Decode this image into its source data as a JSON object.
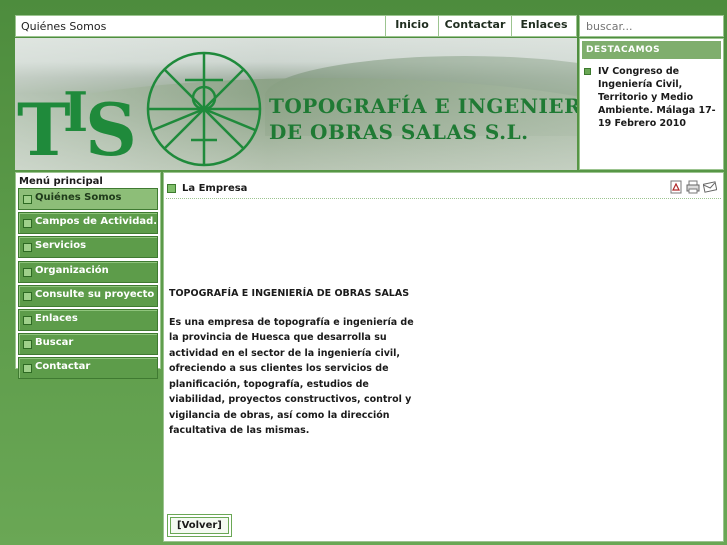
{
  "topbar": {
    "crumb": "Quiénes Somos",
    "nav": [
      "Inicio",
      "Contactar",
      "Enlaces"
    ]
  },
  "search": {
    "placeholder": "buscar..."
  },
  "banner": {
    "logo_t": "T",
    "logo_i": "I",
    "logo_s": "S",
    "line1": "TOPOGRAFÍA E INGENIERÍA",
    "line2": "DE OBRAS SALAS S.L."
  },
  "destacamos": {
    "heading": "DESTACAMOS",
    "item": "IV Congreso de Ingeniería Civil, Territorio y Medio Ambiente. Málaga 17-19 Febrero 2010"
  },
  "menu": {
    "title": "Menú principal",
    "items": [
      "Quiénes Somos",
      "Campos de Actividad.",
      "Servicios",
      "Organización",
      "Consulte su proyecto",
      "Enlaces",
      "Buscar",
      "Contactar"
    ],
    "active_index": 0
  },
  "content": {
    "section": "La Empresa",
    "title": "TOPOGRAFÍA E INGENIERÍA DE OBRAS SALAS",
    "paragraph": "Es una empresa de topografía e ingeniería de la provincia de Huesca que desarrolla su actividad en el sector de la ingeniería civil, ofreciendo a sus clientes los servicios de planificación, topografía, estudios de viabilidad, proyectos constructivos, control y vigilancia de obras, así como la dirección facultativa de las mismas.",
    "back": "[Volver]",
    "tools": [
      "pdf-icon",
      "print-icon",
      "email-icon"
    ]
  },
  "colors": {
    "background": "#5a9948",
    "menu_item": "#5d9c4a",
    "logo_green": "#1f8a3b"
  }
}
